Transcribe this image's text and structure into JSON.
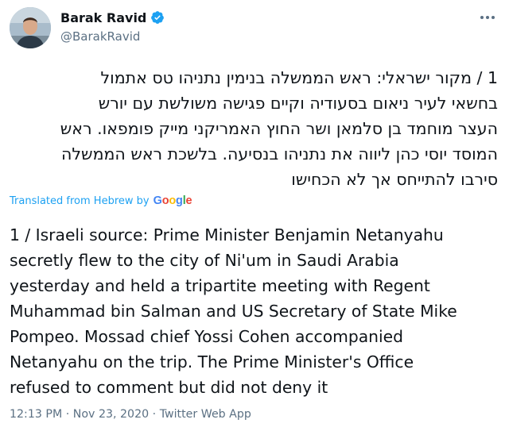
{
  "author": {
    "display_name": "Barak Ravid",
    "handle": "@BarakRavid",
    "verified": true
  },
  "tweet": {
    "hebrew_lines": [
      "1 / מקור ישראלי: ראש הממשלה בנימין נתניהו טס אתמול",
      "בחשאי לעיר ניאום בסעודיה וקיים פגישה משולשת עם יורש",
      "העצר מוחמד בן סלמאן ושר החוץ האמריקני מייק פומפאו. ראש",
      "המוסד יוסי כהן ליווה את נתניהו בנסיעה. בלשכת ראש הממשלה",
      "סירבו להתייחס אך לא הכחישו"
    ],
    "translated_label": "Translated from Hebrew by",
    "translator": "Google",
    "english_lines": [
      "1 / Israeli source: Prime Minister Benjamin Netanyahu",
      "secretly flew to the city of Ni'um in Saudi Arabia",
      "yesterday and held a tripartite meeting with Regent",
      "Muhammad bin Salman and US Secretary of State Mike",
      "Pompeo. Mossad chief Yossi Cohen accompanied",
      "Netanyahu on the trip. The Prime Minister's Office",
      "refused to comment but did not deny it"
    ]
  },
  "meta": {
    "time": "12:13 PM",
    "separator": "·",
    "date": "Nov 23, 2020",
    "source": "Twitter Web App"
  },
  "colors": {
    "accent": "#1da1f2",
    "text": "#0f1419",
    "secondary": "#5b7083"
  },
  "icons": {
    "verified": "verified-badge-icon",
    "more": "more-options-icon",
    "avatar": "profile-photo"
  }
}
